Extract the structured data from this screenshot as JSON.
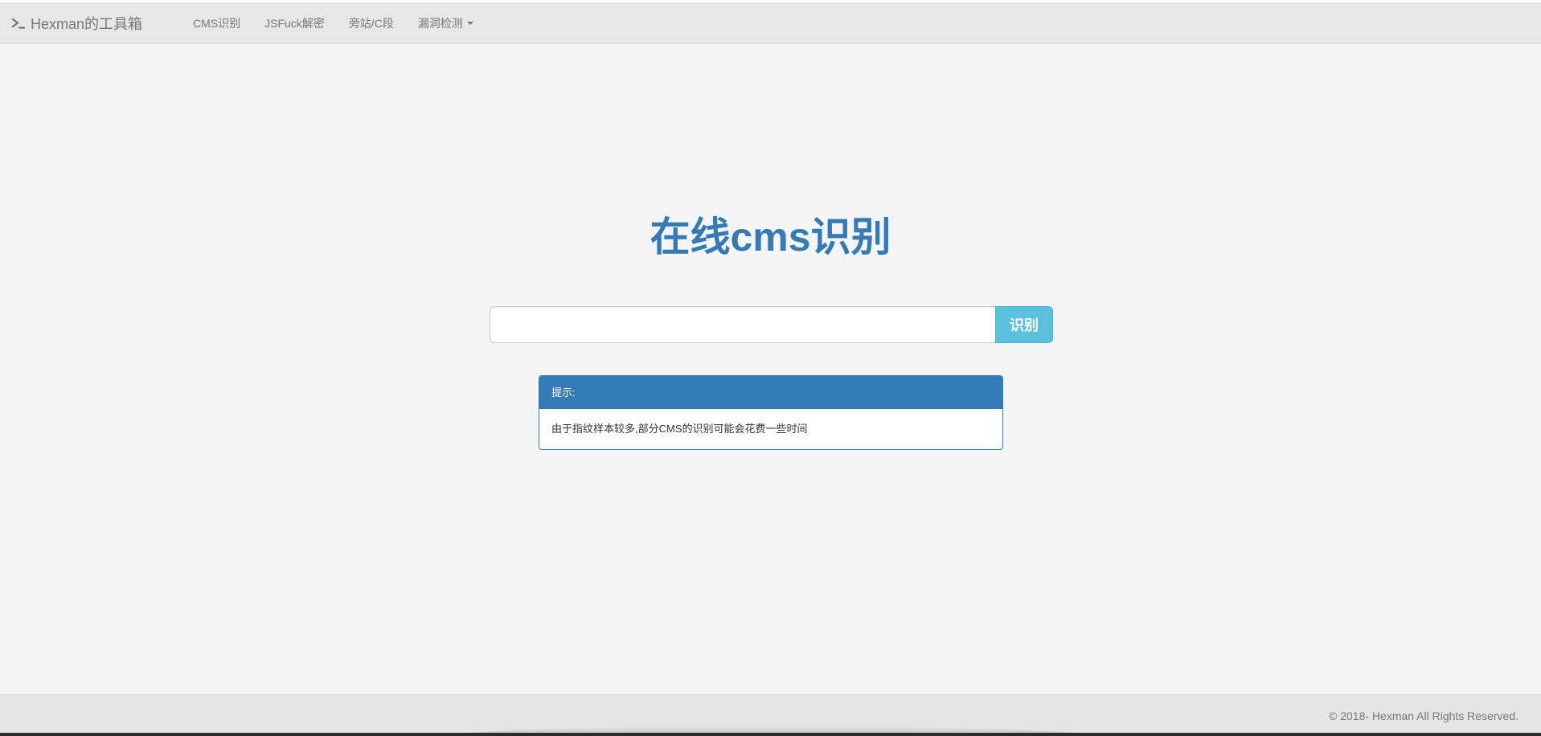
{
  "navbar": {
    "brand": "Hexman的工具箱",
    "brand_icon": "terminal-icon",
    "links": [
      {
        "label": "CMS识别"
      },
      {
        "label": "JSFuck解密"
      },
      {
        "label": "旁站/C段"
      },
      {
        "label": "漏洞检测",
        "dropdown": true
      }
    ]
  },
  "main": {
    "title": "在线cms识别",
    "search": {
      "value": "",
      "placeholder": "",
      "button_label": "识别"
    },
    "notice": {
      "heading": "提示:",
      "body": "由于指纹样本较多,部分CMS的识别可能会花费一些时间"
    }
  },
  "footer": {
    "text": "© 2018- Hexman All Rights Reserved."
  },
  "colors": {
    "primary": "#337ab7",
    "info": "#5bc0de",
    "navbar_bg": "#e7e7e7",
    "page_bg": "#f5f5f5"
  }
}
